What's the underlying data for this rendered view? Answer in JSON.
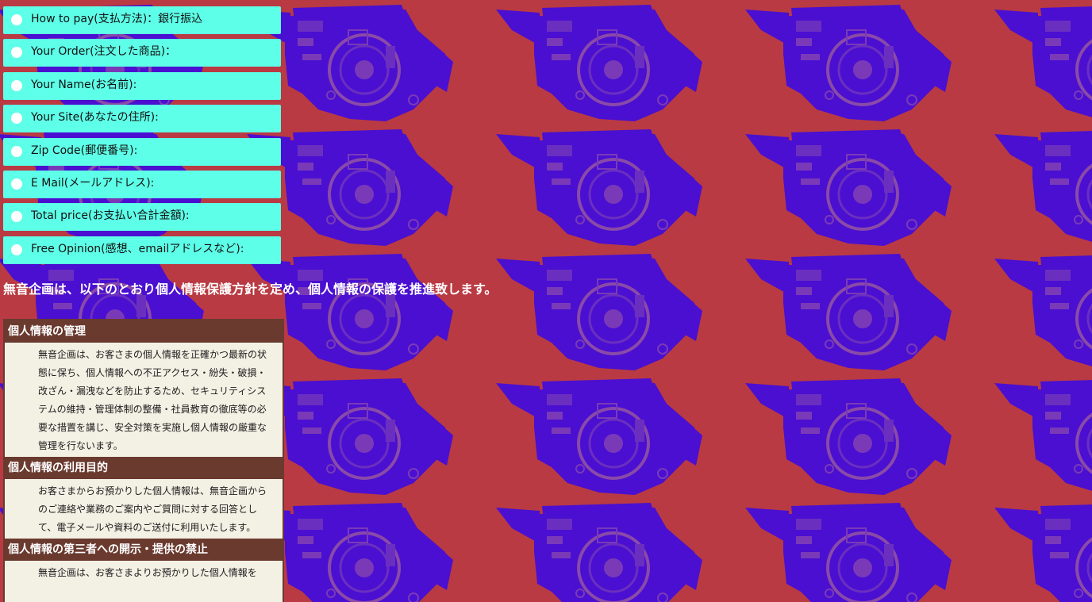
{
  "form": {
    "rows": [
      {
        "label": "How to pay(支払方法)：銀行振込"
      },
      {
        "label": "Your Order(注文した商品)："
      },
      {
        "label": "Your Name(お名前):"
      },
      {
        "label": "Your Site(あなたの住所):"
      },
      {
        "label": "Zip Code(郵便番号):"
      },
      {
        "label": "E Mail(メールアドレス):"
      },
      {
        "label": "Total price(お支払い合計金額):"
      },
      {
        "label": "Free Opinion(感想、emailアドレスなど):"
      }
    ]
  },
  "privacy": {
    "headline": "無音企画は、以下のとおり個人情報保護方針を定め、個人情報の保護を推進致します。",
    "sections": [
      {
        "title": "個人情報の管理",
        "body": "無音企画は、お客さまの個人情報を正確かつ最新の状態に保ち、個人情報への不正アクセス・紛失・破損・改ざん・漏洩などを防止するため、セキュリティシステムの維持・管理体制の整備・社員教育の徹底等の必要な措置を講じ、安全対策を実施し個人情報の厳重な管理を行ないます。"
      },
      {
        "title": "個人情報の利用目的",
        "body": "お客さまからお預かりした個人情報は、無音企画からのご連絡や業務のご案内やご質問に対する回答として、電子メールや資料のご送付に利用いたします。"
      },
      {
        "title": "個人情報の第三者への開示・提供の禁止",
        "body": "無音企画は、お客さまよりお預かりした個人情報を"
      }
    ]
  },
  "colors": {
    "background": "#b93a43",
    "pattern": "#4a0fd0",
    "form_row": "#5effe8",
    "section_header": "#6a3a2f",
    "section_body": "#f3f0e4"
  },
  "icons": {
    "radio": "radio-dot-icon",
    "background": "hard-drive-pattern"
  }
}
